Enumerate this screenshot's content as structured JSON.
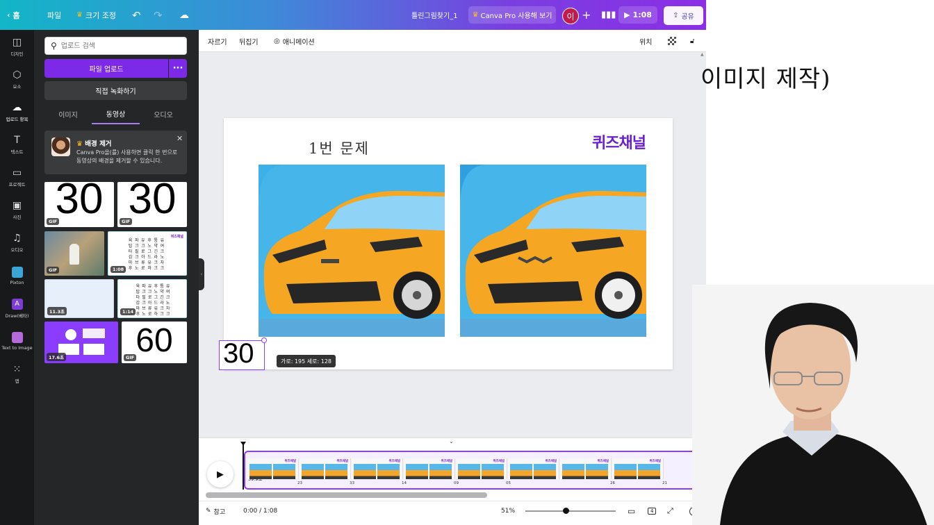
{
  "topbar": {
    "home_label": "홈",
    "file_label": "파일",
    "resize_label": "크기 조정",
    "doc_title": "틀린그림찾기_1",
    "pro_label": "Canva Pro 사용해 보기",
    "avatar_initial": "이",
    "play_time": "1:08",
    "share_label": "공유"
  },
  "rail": {
    "items": [
      {
        "label": "디자인"
      },
      {
        "label": "요소"
      },
      {
        "label": "업로드 항목"
      },
      {
        "label": "텍스트"
      },
      {
        "label": "프로젝트"
      },
      {
        "label": "사진"
      },
      {
        "label": "오디오"
      },
      {
        "label": "Pixton"
      },
      {
        "label": "Draw(베타)"
      },
      {
        "label": "Text to Image"
      },
      {
        "label": "앱"
      }
    ]
  },
  "panel": {
    "search_placeholder": "업로드 검색",
    "upload_label": "파일 업로드",
    "record_label": "직접 녹화하기",
    "tabs": [
      {
        "label": "이미지"
      },
      {
        "label": "동영상"
      },
      {
        "label": "오디오"
      }
    ],
    "promo": {
      "title": "배경 제거",
      "body": "Canva Pro을(를) 사용하면 클릭 한 번으로 동영상의 배경을 제거할 수 있습니다."
    },
    "thumbs": [
      {
        "text": "30",
        "badge": "GIF"
      },
      {
        "text": "30",
        "badge": "GIF"
      },
      {
        "text": "",
        "badge": "GIF"
      },
      {
        "text": "",
        "badge": "1:08"
      },
      {
        "text": "",
        "badge": "11.3초"
      },
      {
        "text": "",
        "badge": "1:14"
      },
      {
        "text": "",
        "badge": "17.6초"
      },
      {
        "text": "60",
        "badge": "GIF"
      }
    ],
    "grid_chars": "육파유후통유탑크크노약여타필로그긴크갑크아드라노마브류유크차후노로하크크",
    "mini_title": "퀴즈채널"
  },
  "toolbar": {
    "crop_label": "자르기",
    "flip_label": "뒤집기",
    "animate_label": "애니메이션",
    "position_label": "위치"
  },
  "page": {
    "title": "1번 문제",
    "brand": "퀴즈채널",
    "selected_text": "30",
    "size_tooltip": "가로: 195 세로: 128"
  },
  "timeline": {
    "track_duration": "59.9초",
    "clip_marks": [
      "23",
      "33",
      "14",
      "09",
      "05",
      "",
      "26",
      "21"
    ]
  },
  "bottom": {
    "notes_label": "참고",
    "time": "0:00 / 1:08",
    "zoom": "51%",
    "page_count": "4"
  },
  "background": {
    "slide_text": "이미지 제작)"
  }
}
